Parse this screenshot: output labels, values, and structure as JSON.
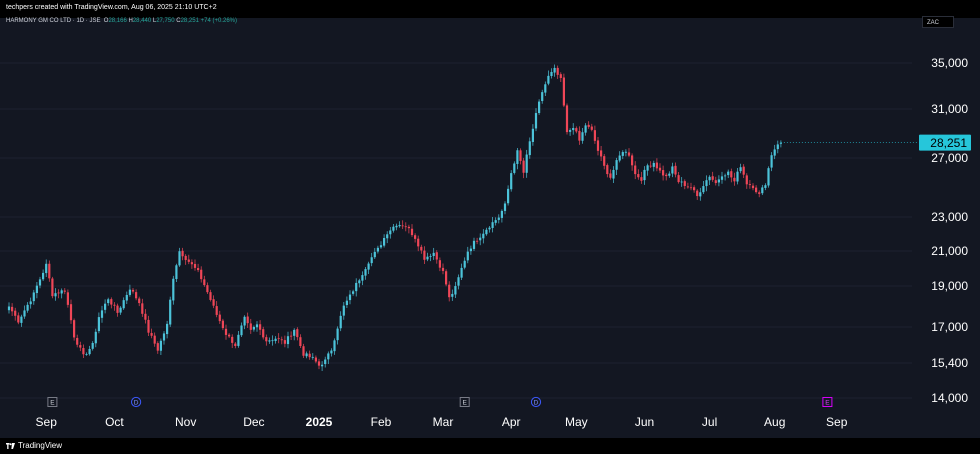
{
  "header": {
    "credit": "techpers created with TradingView.com, Aug 06, 2025 21:10 UTC+2"
  },
  "legend": {
    "symbol": "HARMONY GM CO LTD · 1D · JSE",
    "open_label": "O",
    "open": "28,166",
    "high_label": "H",
    "high": "28,440",
    "low_label": "L",
    "low": "27,750",
    "close_label": "C",
    "close": "28,251",
    "change": "+74 (+0.26%)"
  },
  "currency": "ZAC",
  "footer": {
    "brand": "TradingView"
  },
  "colors": {
    "up": "#4cc3d9",
    "down": "#ef4657",
    "background": "#131722",
    "price_tag": "#26c6da"
  },
  "chart_data": {
    "type": "candlestick",
    "price_axis": {
      "ticks": [
        35000,
        31000,
        27000,
        23000,
        21000,
        19000,
        17000,
        15400,
        14000
      ],
      "tick_labels": [
        "35,000",
        "31,000",
        "27,000",
        "23,000",
        "21,000",
        "19,000",
        "17,000",
        "15,400",
        "14,000"
      ],
      "last_price": 28251,
      "last_price_label": "28,251",
      "range": [
        14000,
        35500
      ]
    },
    "time_axis": {
      "labels": [
        "Sep",
        "Oct",
        "Nov",
        "Dec",
        "2025",
        "Feb",
        "Mar",
        "Apr",
        "May",
        "Jun",
        "Jul",
        "Aug",
        "Sep"
      ],
      "label_index": [
        12,
        34,
        57,
        79,
        100,
        120,
        140,
        162,
        183,
        205,
        226,
        247,
        267
      ]
    },
    "markers": [
      {
        "label": "E",
        "index": 14,
        "kind": "earnings"
      },
      {
        "label": "D",
        "index": 41,
        "kind": "dividend"
      },
      {
        "label": "E",
        "index": 147,
        "kind": "earnings"
      },
      {
        "label": "D",
        "index": 170,
        "kind": "dividend"
      },
      {
        "label": "E",
        "index": 264,
        "kind": "earnings-upcoming"
      }
    ],
    "close_path": [
      [
        0,
        18000
      ],
      [
        3,
        17300
      ],
      [
        8,
        18600
      ],
      [
        12,
        20200
      ],
      [
        14,
        18600
      ],
      [
        18,
        18800
      ],
      [
        21,
        16600
      ],
      [
        24,
        15700
      ],
      [
        27,
        16200
      ],
      [
        29,
        17500
      ],
      [
        32,
        18400
      ],
      [
        35,
        17700
      ],
      [
        39,
        18900
      ],
      [
        42,
        18200
      ],
      [
        45,
        16800
      ],
      [
        48,
        16000
      ],
      [
        51,
        17100
      ],
      [
        53,
        19500
      ],
      [
        55,
        21000
      ],
      [
        58,
        20400
      ],
      [
        61,
        19800
      ],
      [
        64,
        18700
      ],
      [
        67,
        17600
      ],
      [
        70,
        16700
      ],
      [
        73,
        16200
      ],
      [
        76,
        17400
      ],
      [
        78,
        16800
      ],
      [
        80,
        17100
      ],
      [
        83,
        16400
      ],
      [
        86,
        16500
      ],
      [
        89,
        16300
      ],
      [
        92,
        16900
      ],
      [
        95,
        15800
      ],
      [
        98,
        15600
      ],
      [
        100,
        15300
      ],
      [
        102,
        15500
      ],
      [
        104,
        16000
      ],
      [
        106,
        17000
      ],
      [
        108,
        18000
      ],
      [
        110,
        18500
      ],
      [
        113,
        19400
      ],
      [
        116,
        20400
      ],
      [
        119,
        21100
      ],
      [
        122,
        22100
      ],
      [
        125,
        22600
      ],
      [
        128,
        22500
      ],
      [
        131,
        21800
      ],
      [
        134,
        20600
      ],
      [
        137,
        20900
      ],
      [
        140,
        19800
      ],
      [
        142,
        18400
      ],
      [
        144,
        18900
      ],
      [
        146,
        20000
      ],
      [
        148,
        21000
      ],
      [
        150,
        21500
      ],
      [
        152,
        21900
      ],
      [
        155,
        22500
      ],
      [
        158,
        23000
      ],
      [
        160,
        23800
      ],
      [
        162,
        26000
      ],
      [
        164,
        27500
      ],
      [
        166,
        26000
      ],
      [
        168,
        28300
      ],
      [
        170,
        30500
      ],
      [
        172,
        32500
      ],
      [
        174,
        33800
      ],
      [
        176,
        34400
      ],
      [
        178,
        33500
      ],
      [
        180,
        29000
      ],
      [
        182,
        29600
      ],
      [
        184,
        28400
      ],
      [
        186,
        29700
      ],
      [
        188,
        29200
      ],
      [
        190,
        27600
      ],
      [
        192,
        26400
      ],
      [
        194,
        25700
      ],
      [
        196,
        26700
      ],
      [
        198,
        27600
      ],
      [
        200,
        27300
      ],
      [
        202,
        25900
      ],
      [
        204,
        25600
      ],
      [
        206,
        26500
      ],
      [
        208,
        26700
      ],
      [
        210,
        26100
      ],
      [
        212,
        25700
      ],
      [
        214,
        26300
      ],
      [
        216,
        25400
      ],
      [
        218,
        25200
      ],
      [
        220,
        25000
      ],
      [
        222,
        24400
      ],
      [
        224,
        25200
      ],
      [
        226,
        25800
      ],
      [
        228,
        25300
      ],
      [
        230,
        25900
      ],
      [
        232,
        26000
      ],
      [
        234,
        25400
      ],
      [
        236,
        26500
      ],
      [
        238,
        25300
      ],
      [
        240,
        25100
      ],
      [
        242,
        24500
      ],
      [
        244,
        25300
      ],
      [
        246,
        27300
      ],
      [
        248,
        28200
      ],
      [
        249,
        28251
      ]
    ]
  }
}
